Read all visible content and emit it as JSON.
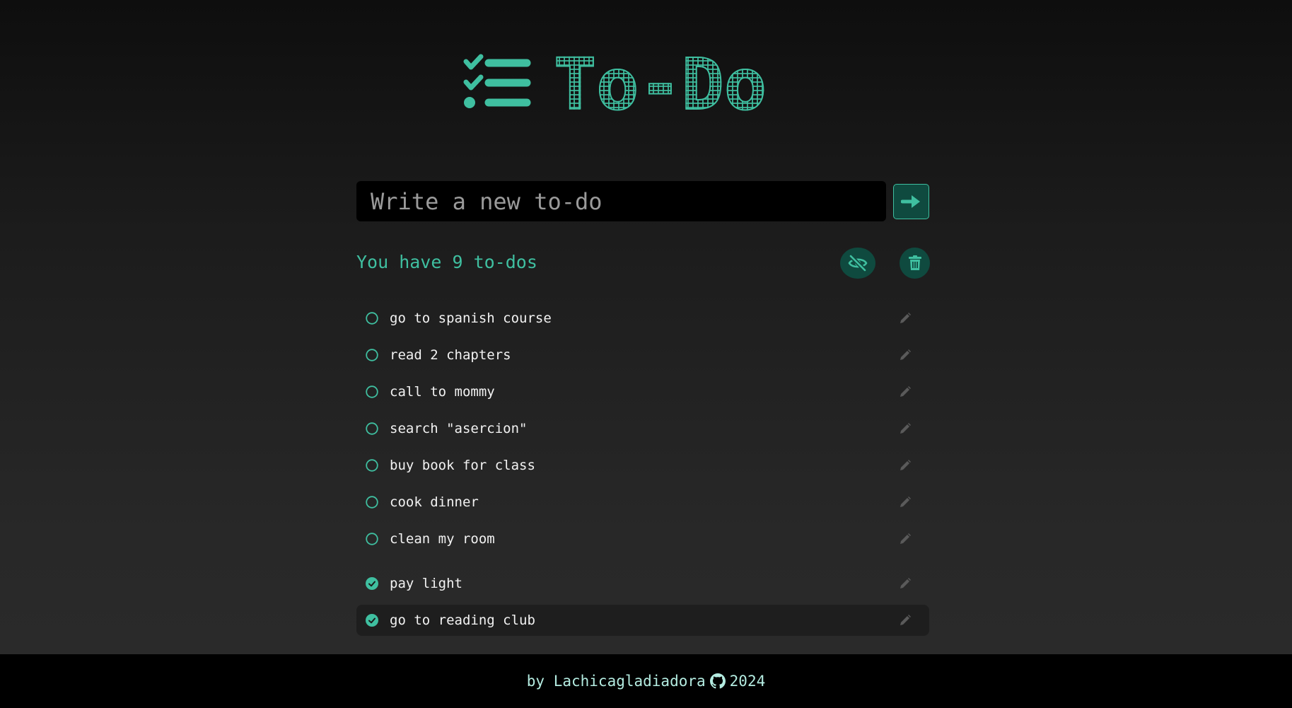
{
  "header": {
    "title": "To-Do",
    "logo_icon": "checklist-icon"
  },
  "new_todo": {
    "placeholder": "Write a new to-do",
    "value": "",
    "submit_icon": "arrow-right-icon"
  },
  "summary": {
    "count_text": "You have 9 to-dos",
    "hide_icon": "eye-slash-icon",
    "delete_icon": "trash-icon"
  },
  "todos": [
    {
      "text": "go to spanish course",
      "done": false
    },
    {
      "text": "read 2 chapters",
      "done": false
    },
    {
      "text": "call to mommy",
      "done": false
    },
    {
      "text": "search \"asercion\"",
      "done": false
    },
    {
      "text": "buy book for class",
      "done": false
    },
    {
      "text": "cook dinner",
      "done": false
    },
    {
      "text": "clean my room",
      "done": false
    },
    {
      "text": "pay light",
      "done": true
    },
    {
      "text": "go to reading club",
      "done": true
    }
  ],
  "footer": {
    "by": "by",
    "author": "Lachicagladiadora",
    "github_icon": "github-icon",
    "year": "2024"
  },
  "colors": {
    "accent": "#3fbfa0",
    "accent_dark": "#0f4a3f",
    "background": "#2a2a2a",
    "footer_bg": "#000000",
    "footer_text": "#b4ece1"
  }
}
